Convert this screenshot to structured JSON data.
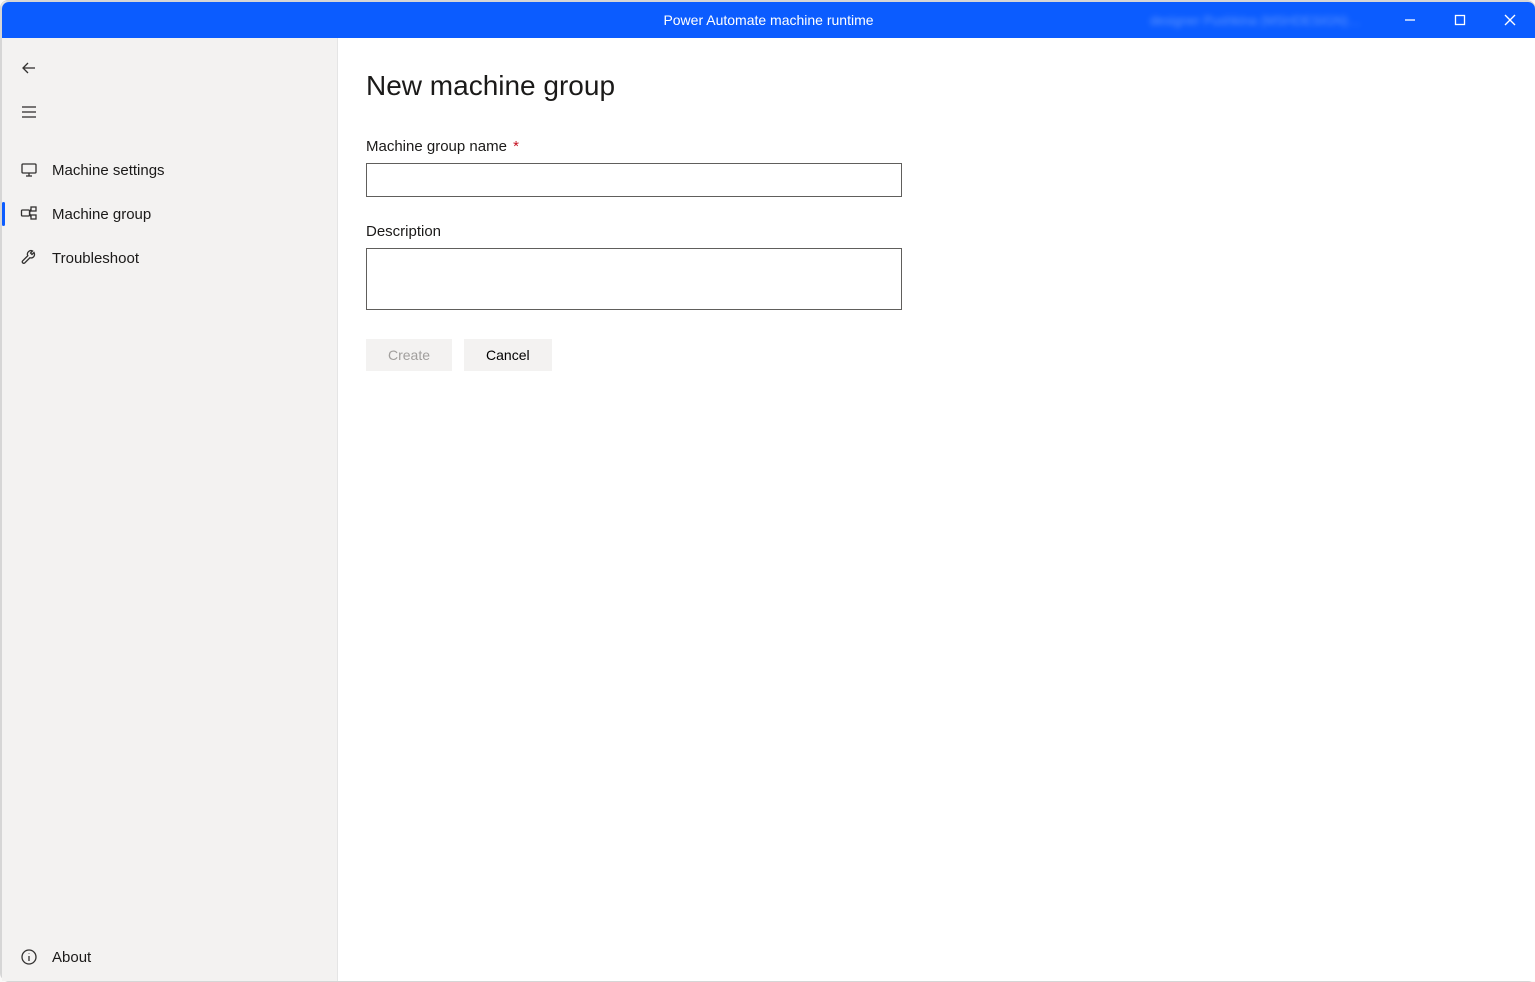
{
  "titlebar": {
    "title": "Power Automate machine runtime",
    "user": "designer Pushkina (MSHDESIGN)…"
  },
  "sidebar": {
    "items": [
      {
        "label": "Machine settings",
        "selected": false
      },
      {
        "label": "Machine group",
        "selected": true
      },
      {
        "label": "Troubleshoot",
        "selected": false
      }
    ],
    "about_label": "About"
  },
  "main": {
    "heading": "New machine group",
    "name_label": "Machine group name",
    "name_value": "",
    "desc_label": "Description",
    "desc_value": "",
    "create_label": "Create",
    "cancel_label": "Cancel"
  }
}
